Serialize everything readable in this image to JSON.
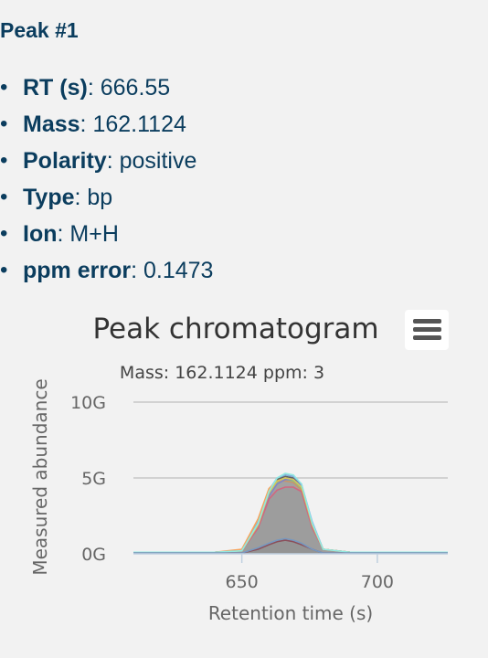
{
  "peak": {
    "title": "Peak #1",
    "props": [
      {
        "key": "RT (s)",
        "value": "666.55"
      },
      {
        "key": "Mass",
        "value": "162.1124"
      },
      {
        "key": "Polarity",
        "value": "positive"
      },
      {
        "key": "Type",
        "value": "bp"
      },
      {
        "key": "Ion",
        "value": "M+H"
      },
      {
        "key": "ppm error",
        "value": "0.1473"
      }
    ]
  },
  "chart_data": {
    "type": "area",
    "title": "Peak chromatogram",
    "subtitle": "Mass: 162.1124 ppm: 3",
    "xlabel": "Retention time (s)",
    "ylabel": "Measured abundance",
    "xlim": [
      610,
      726
    ],
    "ylim": [
      0,
      10
    ],
    "x_ticks": [
      650,
      700
    ],
    "y_ticks": [
      {
        "value": 0,
        "label": "0G"
      },
      {
        "value": 5,
        "label": "5G"
      },
      {
        "value": 10,
        "label": "10G"
      }
    ],
    "grid": true,
    "x": [
      610,
      640,
      650,
      656,
      660,
      663,
      666,
      669,
      672,
      676,
      680,
      690,
      726
    ],
    "series": [
      {
        "color": "#555555",
        "values": [
          0.1,
          0.1,
          0.2,
          2.0,
          4.0,
          4.9,
          5.1,
          5.0,
          4.5,
          2.0,
          0.3,
          0.1,
          0.1
        ]
      },
      {
        "color": "#7cb5ec",
        "values": [
          0.1,
          0.1,
          0.2,
          2.1,
          4.2,
          5.0,
          5.2,
          5.1,
          4.6,
          2.1,
          0.3,
          0.1,
          0.1
        ]
      },
      {
        "color": "#90ed7d",
        "values": [
          0.1,
          0.1,
          0.2,
          1.8,
          3.9,
          4.7,
          4.9,
          4.8,
          4.3,
          1.8,
          0.3,
          0.1,
          0.1
        ]
      },
      {
        "color": "#f7a35c",
        "values": [
          0.1,
          0.1,
          0.3,
          2.3,
          4.3,
          4.8,
          4.8,
          4.7,
          4.2,
          1.9,
          0.3,
          0.1,
          0.1
        ]
      },
      {
        "color": "#8085e9",
        "values": [
          0.1,
          0.1,
          0.2,
          1.9,
          3.8,
          4.6,
          4.9,
          4.9,
          4.5,
          2.0,
          0.3,
          0.1,
          0.1
        ]
      },
      {
        "color": "#f15c80",
        "values": [
          0.1,
          0.1,
          0.2,
          1.7,
          3.6,
          4.2,
          4.4,
          4.4,
          4.1,
          1.7,
          0.3,
          0.1,
          0.1
        ]
      },
      {
        "color": "#e4d354",
        "values": [
          0.1,
          0.1,
          0.2,
          1.9,
          4.0,
          4.8,
          5.0,
          4.9,
          4.4,
          1.9,
          0.3,
          0.1,
          0.1
        ]
      },
      {
        "color": "#91e8e1",
        "values": [
          0.1,
          0.1,
          0.2,
          2.0,
          4.1,
          5.0,
          5.3,
          5.2,
          4.6,
          2.0,
          0.3,
          0.1,
          0.1
        ]
      },
      {
        "color": "#8d4653",
        "values": [
          0.05,
          0.05,
          0.05,
          0.3,
          0.6,
          0.8,
          0.9,
          0.8,
          0.6,
          0.3,
          0.05,
          0.05,
          0.05
        ]
      },
      {
        "color": "#7798bf",
        "values": [
          0.05,
          0.05,
          0.05,
          0.4,
          0.7,
          0.9,
          1.0,
          0.9,
          0.7,
          0.3,
          0.05,
          0.05,
          0.05
        ]
      }
    ]
  },
  "icons": {
    "menu": "hamburger-menu-icon"
  }
}
